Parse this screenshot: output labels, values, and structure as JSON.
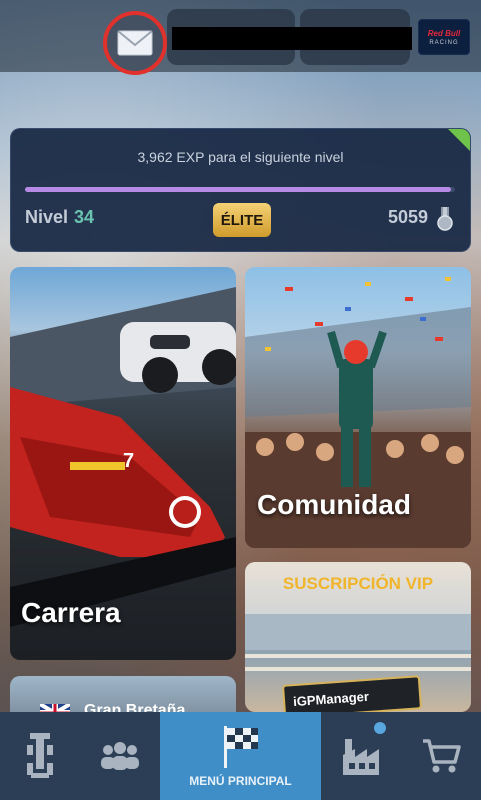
{
  "topbar": {
    "team_logo_line1": "Red Bull",
    "team_logo_line2": "RACING"
  },
  "level_card": {
    "exp_text": "3,962 EXP para el siguiente nivel",
    "exp_progress_fraction": 0.99,
    "level_label": "Nivel",
    "level_value": "34",
    "badge": "ÉLITE",
    "points": "5059"
  },
  "tiles": {
    "carrera": "Carrera",
    "comunidad": "Comunidad",
    "vip_title": "SUSCRIPCIÓN VIP",
    "vip_card_brand": "iGPManager",
    "partial_tile_text": "Gran Bretaña"
  },
  "bottom_nav": {
    "main_label": "MENÚ PRINCIPAL",
    "items": [
      {
        "icon": "car-setup-icon"
      },
      {
        "icon": "people-icon"
      },
      {
        "icon": "checkered-flag-icon"
      },
      {
        "icon": "factory-icon"
      },
      {
        "icon": "shopping-cart-icon"
      }
    ]
  },
  "colors": {
    "accent": "#3f8ec8",
    "mail_highlight": "#e0312c",
    "progress": "#b78ae6",
    "elite_gold": "#f4d275",
    "vip_gold": "#f1b52b"
  }
}
